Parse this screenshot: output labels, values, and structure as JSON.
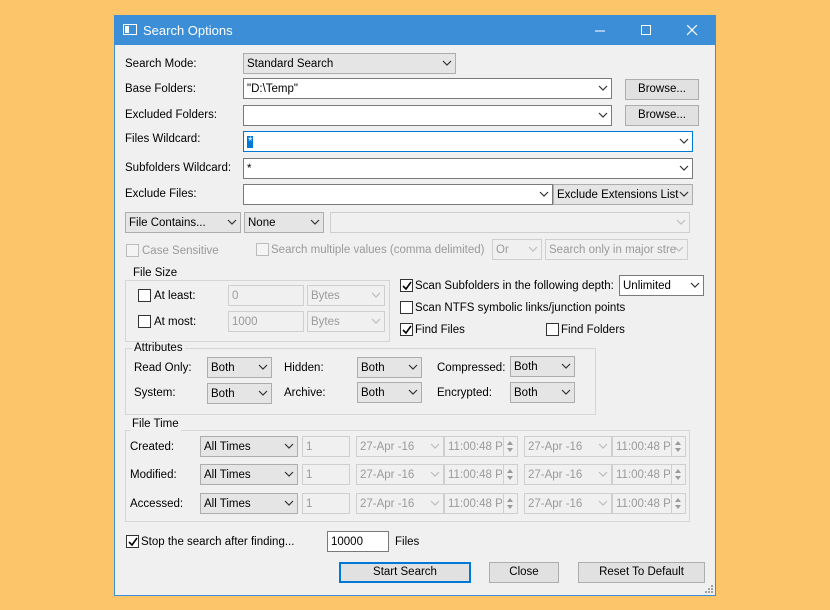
{
  "window": {
    "title": "Search Options",
    "minimize": "—",
    "maximize": "☐",
    "close": "✕"
  },
  "form": {
    "search_mode_label": "Search Mode:",
    "search_mode_value": "Standard Search",
    "base_folders_label": "Base Folders:",
    "base_folders_value": "\"D:\\Temp\"",
    "excluded_folders_label": "Excluded Folders:",
    "excluded_folders_value": "",
    "browse_label": "Browse...",
    "files_wildcard_label": "Files Wildcard:",
    "files_wildcard_value": "*",
    "subfolders_wildcard_label": "Subfolders Wildcard:",
    "subfolders_wildcard_value": "*",
    "exclude_files_label": "Exclude Files:",
    "exclude_files_value": "",
    "exclude_ext_value": "Exclude Extensions List",
    "file_contains_value": "File Contains...",
    "contains_mode_value": "None",
    "contains_text_value": "",
    "case_sensitive_label": "Case Sensitive",
    "search_multiple_label": "Search multiple values (comma delimited)",
    "or_value": "Or",
    "search_only_value": "Search only in major stre"
  },
  "file_size": {
    "title": "File Size",
    "at_least_label": "At least:",
    "at_least_value": "0",
    "at_least_unit": "Bytes",
    "at_most_label": "At most:",
    "at_most_value": "1000",
    "at_most_unit": "Bytes"
  },
  "scan": {
    "scan_subfolders_label": "Scan Subfolders in the following depth:",
    "scan_subfolders_checked": true,
    "depth_value": "Unlimited",
    "scan_ntfs_label": "Scan NTFS symbolic links/junction points",
    "scan_ntfs_checked": false,
    "find_files_label": "Find Files",
    "find_files_checked": true,
    "find_folders_label": "Find Folders",
    "find_folders_checked": false
  },
  "attributes": {
    "title": "Attributes",
    "read_only_label": "Read Only:",
    "read_only_value": "Both",
    "hidden_label": "Hidden:",
    "hidden_value": "Both",
    "compressed_label": "Compressed:",
    "compressed_value": "Both",
    "system_label": "System:",
    "system_value": "Both",
    "archive_label": "Archive:",
    "archive_value": "Both",
    "encrypted_label": "Encrypted:",
    "encrypted_value": "Both"
  },
  "file_time": {
    "title": "File Time",
    "rows": [
      {
        "label": "Created:",
        "mode": "All Times",
        "count": "1",
        "date1": "27-Apr -16",
        "time1": "11:00:48 P",
        "date2": "27-Apr -16",
        "time2": "11:00:48 P"
      },
      {
        "label": "Modified:",
        "mode": "All Times",
        "count": "1",
        "date1": "27-Apr -16",
        "time1": "11:00:48 P",
        "date2": "27-Apr -16",
        "time2": "11:00:48 P"
      },
      {
        "label": "Accessed:",
        "mode": "All Times",
        "count": "1",
        "date1": "27-Apr -16",
        "time1": "11:00:48 P",
        "date2": "27-Apr -16",
        "time2": "11:00:48 P"
      }
    ]
  },
  "stop": {
    "label": "Stop the search after finding...",
    "checked": true,
    "value": "10000",
    "unit": "Files"
  },
  "buttons": {
    "start": "Start Search",
    "close": "Close",
    "reset": "Reset To Default"
  }
}
